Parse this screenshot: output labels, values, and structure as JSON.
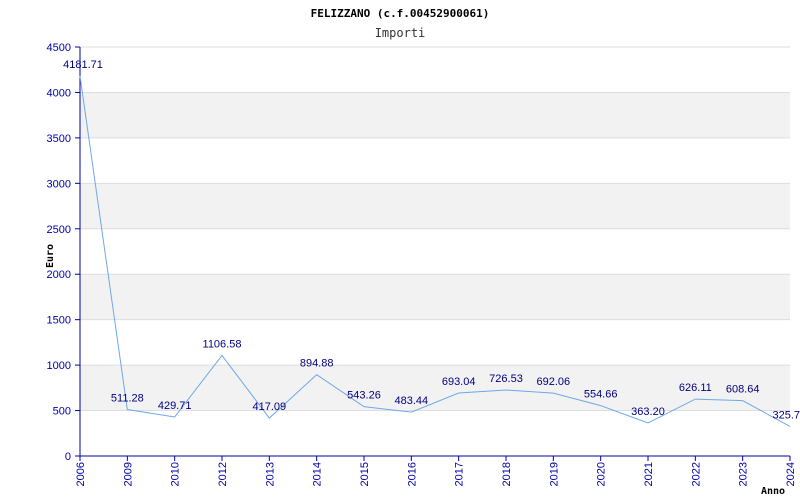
{
  "chart_data": {
    "type": "line",
    "title": "FELIZZANO (c.f.00452900061)",
    "subtitle": "Importi",
    "xlabel": "Anno",
    "ylabel": "Euro",
    "ylim": [
      0,
      4500
    ],
    "yticks": [
      0,
      500,
      1000,
      1500,
      2000,
      2500,
      3000,
      3500,
      4000,
      4500
    ],
    "grid": "horizontal bands",
    "categories": [
      "2006",
      "2009",
      "2010",
      "2012",
      "2013",
      "2014",
      "2015",
      "2016",
      "2017",
      "2018",
      "2019",
      "2020",
      "2021",
      "2022",
      "2023",
      "2024"
    ],
    "series": [
      {
        "values": [
          4181.71,
          511.28,
          429.71,
          1106.58,
          417.09,
          894.88,
          543.26,
          483.44,
          693.04,
          726.53,
          692.06,
          554.66,
          363.2,
          626.11,
          608.64,
          325.7
        ],
        "labels": [
          "4181.71",
          "511.28",
          "429.71",
          "1106.58",
          "417.09",
          "894.88",
          "543.26",
          "483.44",
          "693.04",
          "726.53",
          "692.06",
          "554.66",
          "363.20",
          "626.11",
          "608.64",
          "325.7"
        ]
      }
    ],
    "colors": {
      "line": "#6fa8e8",
      "band": "#f2f2f2",
      "axis": "#0000aa",
      "tick_text": "#0000aa",
      "label_text": "#000080"
    }
  }
}
